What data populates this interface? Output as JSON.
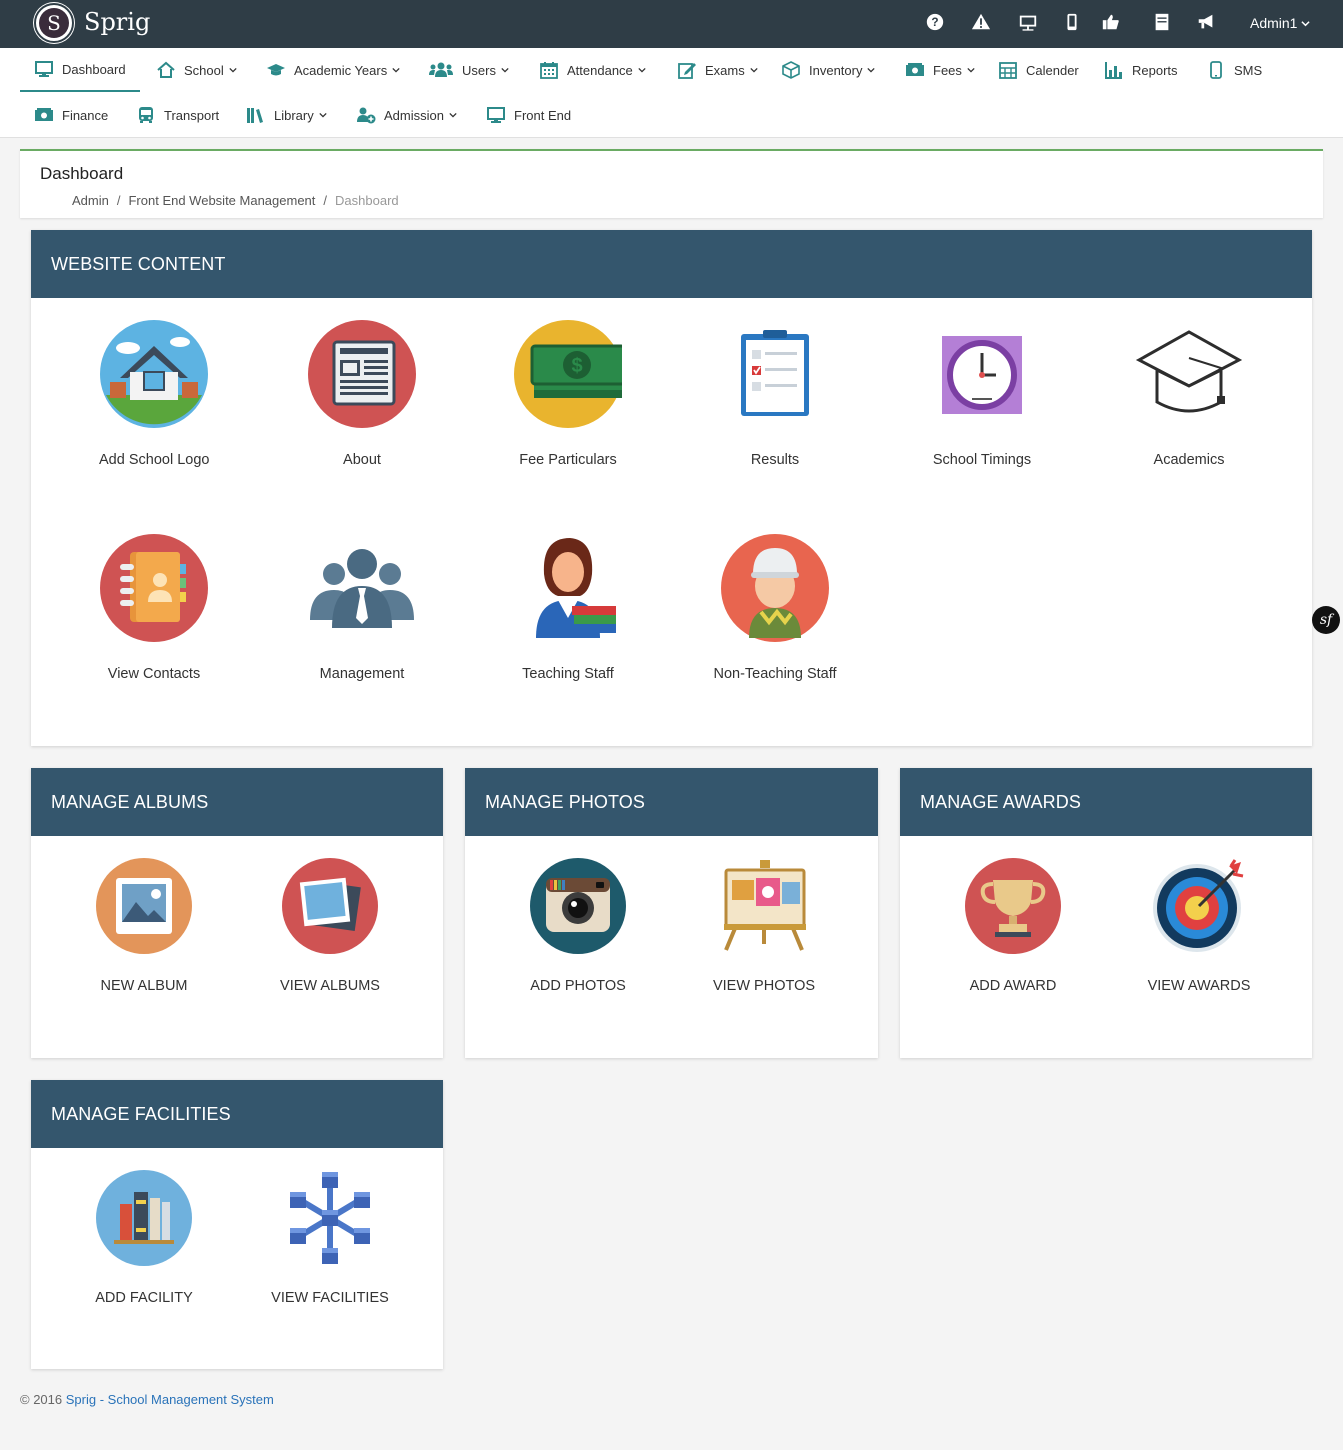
{
  "app": {
    "brand": "Sprig",
    "logo_letter": "S",
    "user": "Admin1"
  },
  "top_icons": [
    "help-icon",
    "warning-icon",
    "presentation-icon",
    "mobile-icon",
    "thumbs-up-icon",
    "notes-icon",
    "megaphone-icon"
  ],
  "menu": {
    "row1": [
      {
        "label": "Dashboard",
        "icon": "monitor-icon",
        "active": true,
        "caret": false
      },
      {
        "label": "School",
        "icon": "home-icon",
        "caret": true
      },
      {
        "label": "Academic Years",
        "icon": "graduation-cap-icon",
        "caret": true
      },
      {
        "label": "Users",
        "icon": "users-icon",
        "caret": true
      },
      {
        "label": "Attendance",
        "icon": "calendar-icon",
        "caret": true
      },
      {
        "label": "Exams",
        "icon": "edit-icon",
        "caret": true
      },
      {
        "label": "Inventory",
        "icon": "cube-icon",
        "caret": true
      },
      {
        "label": "Fees",
        "icon": "money-icon",
        "caret": true
      },
      {
        "label": "Calender",
        "icon": "calendar-grid-icon",
        "caret": false
      },
      {
        "label": "Reports",
        "icon": "bar-chart-icon",
        "caret": false
      },
      {
        "label": "SMS",
        "icon": "phone-icon",
        "caret": false
      }
    ],
    "row2": [
      {
        "label": "Finance",
        "icon": "money-icon",
        "caret": false
      },
      {
        "label": "Transport",
        "icon": "bus-icon",
        "caret": false
      },
      {
        "label": "Library",
        "icon": "books-icon",
        "caret": true
      },
      {
        "label": "Admission",
        "icon": "user-plus-icon",
        "caret": true
      },
      {
        "label": "Front End",
        "icon": "monitor-icon",
        "caret": false
      }
    ]
  },
  "breadcrumb": {
    "title": "Dashboard",
    "items": [
      "Admin",
      "Front End Website Management",
      "Dashboard"
    ]
  },
  "website_content": {
    "title": "WEBSITE CONTENT",
    "tiles": [
      {
        "label": "Add School Logo",
        "icon": "school-house-icon"
      },
      {
        "label": "About",
        "icon": "newspaper-icon"
      },
      {
        "label": "Fee Particulars",
        "icon": "cash-icon"
      },
      {
        "label": "Results",
        "icon": "clipboard-checklist-icon"
      },
      {
        "label": "School Timings",
        "icon": "clock-icon"
      },
      {
        "label": "Academics",
        "icon": "mortarboard-icon"
      },
      {
        "label": "View Contacts",
        "icon": "address-book-icon"
      },
      {
        "label": "Management",
        "icon": "team-icon"
      },
      {
        "label": "Teaching Staff",
        "icon": "teacher-icon"
      },
      {
        "label": "Non-Teaching Staff",
        "icon": "worker-icon"
      }
    ]
  },
  "albums": {
    "title": "MANAGE ALBUMS",
    "tiles": [
      {
        "label": "NEW ALBUM",
        "icon": "picture-icon"
      },
      {
        "label": "VIEW ALBUMS",
        "icon": "photos-stack-icon"
      }
    ]
  },
  "photos": {
    "title": "MANAGE PHOTOS",
    "tiles": [
      {
        "label": "ADD PHOTOS",
        "icon": "camera-icon"
      },
      {
        "label": "VIEW PHOTOS",
        "icon": "easel-gallery-icon"
      }
    ]
  },
  "awards": {
    "title": "MANAGE AWARDS",
    "tiles": [
      {
        "label": "ADD AWARD",
        "icon": "trophy-icon"
      },
      {
        "label": "VIEW AWARDS",
        "icon": "target-icon"
      }
    ]
  },
  "facilities": {
    "title": "MANAGE FACILITIES",
    "tiles": [
      {
        "label": "ADD FACILITY",
        "icon": "books-shelf-icon"
      },
      {
        "label": "VIEW FACILITIES",
        "icon": "network-cubes-icon"
      }
    ]
  },
  "footer": {
    "copyright": "© 2016",
    "link": "Sprig - School Management System"
  },
  "badge": "sf",
  "colors": {
    "topbar": "#2f3d46",
    "panel_head": "#34566d",
    "accent": "#2c8a8a",
    "crumb_border": "#6aab63"
  }
}
